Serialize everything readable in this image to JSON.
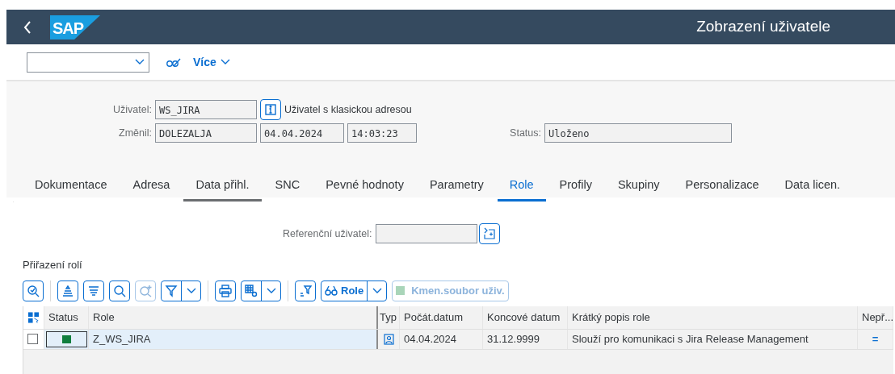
{
  "shell": {
    "logo": "SAP",
    "title": "Zobrazení uživatele"
  },
  "toolbar": {
    "more_label": "Více"
  },
  "header": {
    "user_label": "Uživatel:",
    "user_value": "WS_JIRA",
    "user_info": "Uživatel s klasickou adresou",
    "changed_label": "Změnil:",
    "changed_by": "DOLEZALJA",
    "changed_date": "04.04.2024",
    "changed_time": "14:03:23",
    "status_label": "Status:",
    "status_value": "Uloženo"
  },
  "tabs": [
    {
      "label": "Dokumentace",
      "selected": false
    },
    {
      "label": "Adresa",
      "selected": false
    },
    {
      "label": "Data přihl.",
      "selected": false,
      "hover": true
    },
    {
      "label": "SNC",
      "selected": false
    },
    {
      "label": "Pevné hodnoty",
      "selected": false
    },
    {
      "label": "Parametry",
      "selected": false
    },
    {
      "label": "Role",
      "selected": true
    },
    {
      "label": "Profily",
      "selected": false
    },
    {
      "label": "Skupiny",
      "selected": false
    },
    {
      "label": "Personalizace",
      "selected": false
    },
    {
      "label": "Data licen.",
      "selected": false
    }
  ],
  "reference": {
    "label": "Referenční uživatel:"
  },
  "section_title": "Přiřazení rolí",
  "table_toolbar": [
    {
      "kind": "icon",
      "disabled": false
    },
    {
      "kind": "separator"
    },
    {
      "kind": "icon",
      "disabled": false
    },
    {
      "kind": "icon",
      "disabled": false
    },
    {
      "kind": "icon",
      "disabled": false
    },
    {
      "kind": "icon",
      "disabled": true
    },
    {
      "kind": "split",
      "disabled": false
    },
    {
      "kind": "separator"
    },
    {
      "kind": "icon",
      "disabled": false
    },
    {
      "kind": "split",
      "disabled": false
    },
    {
      "kind": "separator"
    },
    {
      "kind": "icon",
      "disabled": false
    },
    {
      "kind": "split",
      "label": "Role",
      "disabled": false
    },
    {
      "kind": "button",
      "label": "Kmen.soubor uživ.",
      "disabled": true
    }
  ],
  "table": {
    "columns": [
      "Status",
      "Role",
      "Typ",
      "Počát.datum",
      "Koncové datum",
      "Krátký popis role",
      "Nepř..."
    ],
    "rows": [
      {
        "checked": false,
        "selected": true,
        "color": "#107e3e",
        "role": "Z_WS_JIRA",
        "start": "04.04.2024",
        "end": "31.12.9999",
        "description": "Slouží pro komunikaci s Jira Release Management",
        "column_7": "="
      }
    ]
  }
}
